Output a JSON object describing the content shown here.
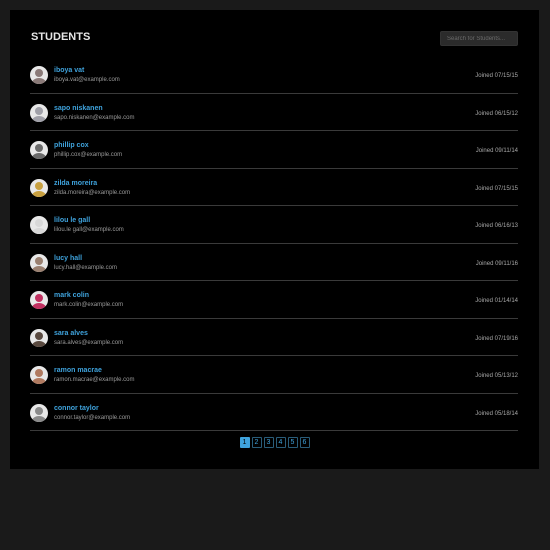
{
  "header": {
    "title": "STUDENTS",
    "search_placeholder": "Search for Students..."
  },
  "students": [
    {
      "name": "iboya vat",
      "email": "iboya.vat@example.com",
      "joined": "Joined 07/15/15",
      "avatar_color": "#8a7a78"
    },
    {
      "name": "sapo niskanen",
      "email": "sapo.niskanen@example.com",
      "joined": "Joined 06/15/12",
      "avatar_color": "#a0a0a8"
    },
    {
      "name": "phillip cox",
      "email": "phillip.cox@example.com",
      "joined": "Joined 09/11/14",
      "avatar_color": "#6a6a6a"
    },
    {
      "name": "zilda moreira",
      "email": "zilda.moreira@example.com",
      "joined": "Joined 07/15/15",
      "avatar_color": "#c8a040"
    },
    {
      "name": "lilou le gall",
      "email": "lilou.le gall@example.com",
      "joined": "Joined 06/16/13",
      "avatar_color": "#d8d8d8"
    },
    {
      "name": "lucy hall",
      "email": "lucy.hall@example.com",
      "joined": "Joined 09/11/16",
      "avatar_color": "#9a8070"
    },
    {
      "name": "mark colin",
      "email": "mark.colin@example.com",
      "joined": "Joined 01/14/14",
      "avatar_color": "#c03060"
    },
    {
      "name": "sara alves",
      "email": "sara.alves@example.com",
      "joined": "Joined 07/19/16",
      "avatar_color": "#5a4a40"
    },
    {
      "name": "ramon macrae",
      "email": "ramon.macrae@example.com",
      "joined": "Joined 05/13/12",
      "avatar_color": "#b07a60"
    },
    {
      "name": "connor taylor",
      "email": "connor.taylor@example.com",
      "joined": "Joined 05/18/14",
      "avatar_color": "#8a8a8a"
    }
  ],
  "pagination": {
    "pages": [
      "1",
      "2",
      "3",
      "4",
      "5",
      "6"
    ],
    "active_page": "1"
  },
  "colors": {
    "accent": "#3fa3dd",
    "background": "#000000",
    "outer_background": "#1a1a1a"
  }
}
